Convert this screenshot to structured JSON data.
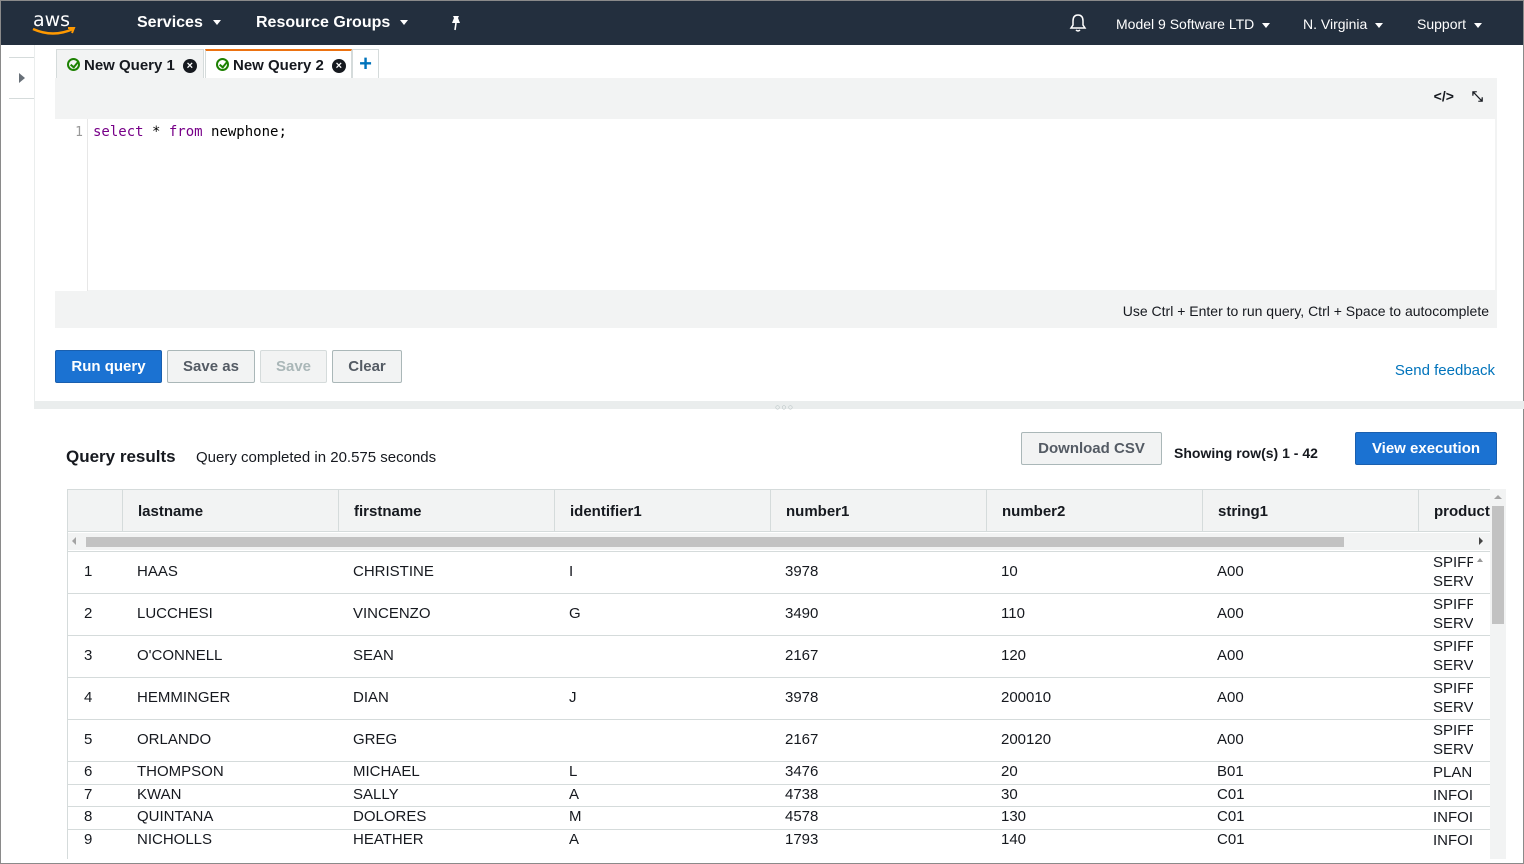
{
  "nav": {
    "logo_text": "aws",
    "services": "Services",
    "resource_groups": "Resource Groups",
    "account": "Model 9 Software LTD",
    "region": "N. Virginia",
    "support": "Support"
  },
  "tabs": [
    {
      "label": "New Query 1",
      "status": "success",
      "active": false
    },
    {
      "label": "New Query 2",
      "status": "success",
      "active": true
    }
  ],
  "add_tab_label": "+",
  "editor": {
    "line_number": "1",
    "code_tokens": [
      "select",
      " * ",
      "from",
      " newphone;"
    ],
    "format_icon": "</>",
    "collapse_icon": "⤡",
    "hint": "Use Ctrl + Enter to run query, Ctrl + Space to autocomplete"
  },
  "actions": {
    "run": "Run query",
    "save_as": "Save as",
    "save": "Save",
    "clear": "Clear",
    "feedback": "Send feedback"
  },
  "results": {
    "title": "Query results",
    "status": "Query completed in 20.575 seconds",
    "download": "Download CSV",
    "row_count": "Showing row(s) 1 - 42",
    "view_execution": "View execution",
    "columns": [
      "",
      "lastname",
      "firstname",
      "identifier1",
      "number1",
      "number2",
      "string1",
      "product"
    ],
    "rows": [
      {
        "n": "1",
        "lastname": "HAAS",
        "firstname": "CHRISTINE",
        "identifier1": "I",
        "number1": "3978",
        "number2": "10",
        "string1": "A00",
        "product_1": "SPIFF",
        "product_2": "SERV"
      },
      {
        "n": "2",
        "lastname": "LUCCHESI",
        "firstname": "VINCENZO",
        "identifier1": "G",
        "number1": "3490",
        "number2": "110",
        "string1": "A00",
        "product_1": "SPIFF",
        "product_2": "SERV"
      },
      {
        "n": "3",
        "lastname": "O'CONNELL",
        "firstname": "SEAN",
        "identifier1": "",
        "number1": "2167",
        "number2": "120",
        "string1": "A00",
        "product_1": "SPIFF",
        "product_2": "SERV"
      },
      {
        "n": "4",
        "lastname": "HEMMINGER",
        "firstname": "DIAN",
        "identifier1": "J",
        "number1": "3978",
        "number2": "200010",
        "string1": "A00",
        "product_1": "SPIFF",
        "product_2": "SERV"
      },
      {
        "n": "5",
        "lastname": "ORLANDO",
        "firstname": "GREG",
        "identifier1": "",
        "number1": "2167",
        "number2": "200120",
        "string1": "A00",
        "product_1": "SPIFF",
        "product_2": "SERV"
      },
      {
        "n": "6",
        "lastname": "THOMPSON",
        "firstname": "MICHAEL",
        "identifier1": "L",
        "number1": "3476",
        "number2": "20",
        "string1": "B01",
        "product_1": "PLAN",
        "product_2": ""
      },
      {
        "n": "7",
        "lastname": "KWAN",
        "firstname": "SALLY",
        "identifier1": "A",
        "number1": "4738",
        "number2": "30",
        "string1": "C01",
        "product_1": "INFOI",
        "product_2": ""
      },
      {
        "n": "8",
        "lastname": "QUINTANA",
        "firstname": "DOLORES",
        "identifier1": "M",
        "number1": "4578",
        "number2": "130",
        "string1": "C01",
        "product_1": "INFOI",
        "product_2": ""
      },
      {
        "n": "9",
        "lastname": "NICHOLLS",
        "firstname": "HEATHER",
        "identifier1": "A",
        "number1": "1793",
        "number2": "140",
        "string1": "C01",
        "product_1": "INFOI",
        "product_2": ""
      }
    ]
  },
  "icons": {
    "bell": "bell-icon",
    "pin": "pin-icon",
    "success": "check-circle-icon",
    "close": "close-circle-icon"
  },
  "colors": {
    "nav_bg": "#232f3e",
    "primary": "#1b72d2",
    "active_tab": "#ec7211",
    "link": "#0073bb",
    "success": "#1d8102"
  }
}
